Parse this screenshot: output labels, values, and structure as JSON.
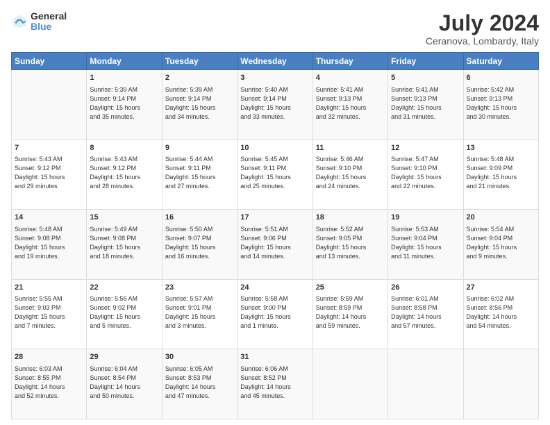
{
  "logo": {
    "general": "General",
    "blue": "Blue"
  },
  "title": "July 2024",
  "subtitle": "Ceranova, Lombardy, Italy",
  "header_row": [
    "Sunday",
    "Monday",
    "Tuesday",
    "Wednesday",
    "Thursday",
    "Friday",
    "Saturday"
  ],
  "weeks": [
    [
      {
        "day": "",
        "lines": []
      },
      {
        "day": "1",
        "lines": [
          "Sunrise: 5:39 AM",
          "Sunset: 9:14 PM",
          "Daylight: 15 hours",
          "and 35 minutes."
        ]
      },
      {
        "day": "2",
        "lines": [
          "Sunrise: 5:39 AM",
          "Sunset: 9:14 PM",
          "Daylight: 15 hours",
          "and 34 minutes."
        ]
      },
      {
        "day": "3",
        "lines": [
          "Sunrise: 5:40 AM",
          "Sunset: 9:14 PM",
          "Daylight: 15 hours",
          "and 33 minutes."
        ]
      },
      {
        "day": "4",
        "lines": [
          "Sunrise: 5:41 AM",
          "Sunset: 9:13 PM",
          "Daylight: 15 hours",
          "and 32 minutes."
        ]
      },
      {
        "day": "5",
        "lines": [
          "Sunrise: 5:41 AM",
          "Sunset: 9:13 PM",
          "Daylight: 15 hours",
          "and 31 minutes."
        ]
      },
      {
        "day": "6",
        "lines": [
          "Sunrise: 5:42 AM",
          "Sunset: 9:13 PM",
          "Daylight: 15 hours",
          "and 30 minutes."
        ]
      }
    ],
    [
      {
        "day": "7",
        "lines": [
          "Sunrise: 5:43 AM",
          "Sunset: 9:12 PM",
          "Daylight: 15 hours",
          "and 29 minutes."
        ]
      },
      {
        "day": "8",
        "lines": [
          "Sunrise: 5:43 AM",
          "Sunset: 9:12 PM",
          "Daylight: 15 hours",
          "and 28 minutes."
        ]
      },
      {
        "day": "9",
        "lines": [
          "Sunrise: 5:44 AM",
          "Sunset: 9:11 PM",
          "Daylight: 15 hours",
          "and 27 minutes."
        ]
      },
      {
        "day": "10",
        "lines": [
          "Sunrise: 5:45 AM",
          "Sunset: 9:11 PM",
          "Daylight: 15 hours",
          "and 25 minutes."
        ]
      },
      {
        "day": "11",
        "lines": [
          "Sunrise: 5:46 AM",
          "Sunset: 9:10 PM",
          "Daylight: 15 hours",
          "and 24 minutes."
        ]
      },
      {
        "day": "12",
        "lines": [
          "Sunrise: 5:47 AM",
          "Sunset: 9:10 PM",
          "Daylight: 15 hours",
          "and 22 minutes."
        ]
      },
      {
        "day": "13",
        "lines": [
          "Sunrise: 5:48 AM",
          "Sunset: 9:09 PM",
          "Daylight: 15 hours",
          "and 21 minutes."
        ]
      }
    ],
    [
      {
        "day": "14",
        "lines": [
          "Sunrise: 5:48 AM",
          "Sunset: 9:08 PM",
          "Daylight: 15 hours",
          "and 19 minutes."
        ]
      },
      {
        "day": "15",
        "lines": [
          "Sunrise: 5:49 AM",
          "Sunset: 9:08 PM",
          "Daylight: 15 hours",
          "and 18 minutes."
        ]
      },
      {
        "day": "16",
        "lines": [
          "Sunrise: 5:50 AM",
          "Sunset: 9:07 PM",
          "Daylight: 15 hours",
          "and 16 minutes."
        ]
      },
      {
        "day": "17",
        "lines": [
          "Sunrise: 5:51 AM",
          "Sunset: 9:06 PM",
          "Daylight: 15 hours",
          "and 14 minutes."
        ]
      },
      {
        "day": "18",
        "lines": [
          "Sunrise: 5:52 AM",
          "Sunset: 9:05 PM",
          "Daylight: 15 hours",
          "and 13 minutes."
        ]
      },
      {
        "day": "19",
        "lines": [
          "Sunrise: 5:53 AM",
          "Sunset: 9:04 PM",
          "Daylight: 15 hours",
          "and 11 minutes."
        ]
      },
      {
        "day": "20",
        "lines": [
          "Sunrise: 5:54 AM",
          "Sunset: 9:04 PM",
          "Daylight: 15 hours",
          "and 9 minutes."
        ]
      }
    ],
    [
      {
        "day": "21",
        "lines": [
          "Sunrise: 5:55 AM",
          "Sunset: 9:03 PM",
          "Daylight: 15 hours",
          "and 7 minutes."
        ]
      },
      {
        "day": "22",
        "lines": [
          "Sunrise: 5:56 AM",
          "Sunset: 9:02 PM",
          "Daylight: 15 hours",
          "and 5 minutes."
        ]
      },
      {
        "day": "23",
        "lines": [
          "Sunrise: 5:57 AM",
          "Sunset: 9:01 PM",
          "Daylight: 15 hours",
          "and 3 minutes."
        ]
      },
      {
        "day": "24",
        "lines": [
          "Sunrise: 5:58 AM",
          "Sunset: 9:00 PM",
          "Daylight: 15 hours",
          "and 1 minute."
        ]
      },
      {
        "day": "25",
        "lines": [
          "Sunrise: 5:59 AM",
          "Sunset: 8:59 PM",
          "Daylight: 14 hours",
          "and 59 minutes."
        ]
      },
      {
        "day": "26",
        "lines": [
          "Sunrise: 6:01 AM",
          "Sunset: 8:58 PM",
          "Daylight: 14 hours",
          "and 57 minutes."
        ]
      },
      {
        "day": "27",
        "lines": [
          "Sunrise: 6:02 AM",
          "Sunset: 8:56 PM",
          "Daylight: 14 hours",
          "and 54 minutes."
        ]
      }
    ],
    [
      {
        "day": "28",
        "lines": [
          "Sunrise: 6:03 AM",
          "Sunset: 8:55 PM",
          "Daylight: 14 hours",
          "and 52 minutes."
        ]
      },
      {
        "day": "29",
        "lines": [
          "Sunrise: 6:04 AM",
          "Sunset: 8:54 PM",
          "Daylight: 14 hours",
          "and 50 minutes."
        ]
      },
      {
        "day": "30",
        "lines": [
          "Sunrise: 6:05 AM",
          "Sunset: 8:53 PM",
          "Daylight: 14 hours",
          "and 47 minutes."
        ]
      },
      {
        "day": "31",
        "lines": [
          "Sunrise: 6:06 AM",
          "Sunset: 8:52 PM",
          "Daylight: 14 hours",
          "and 45 minutes."
        ]
      },
      {
        "day": "",
        "lines": []
      },
      {
        "day": "",
        "lines": []
      },
      {
        "day": "",
        "lines": []
      }
    ]
  ]
}
